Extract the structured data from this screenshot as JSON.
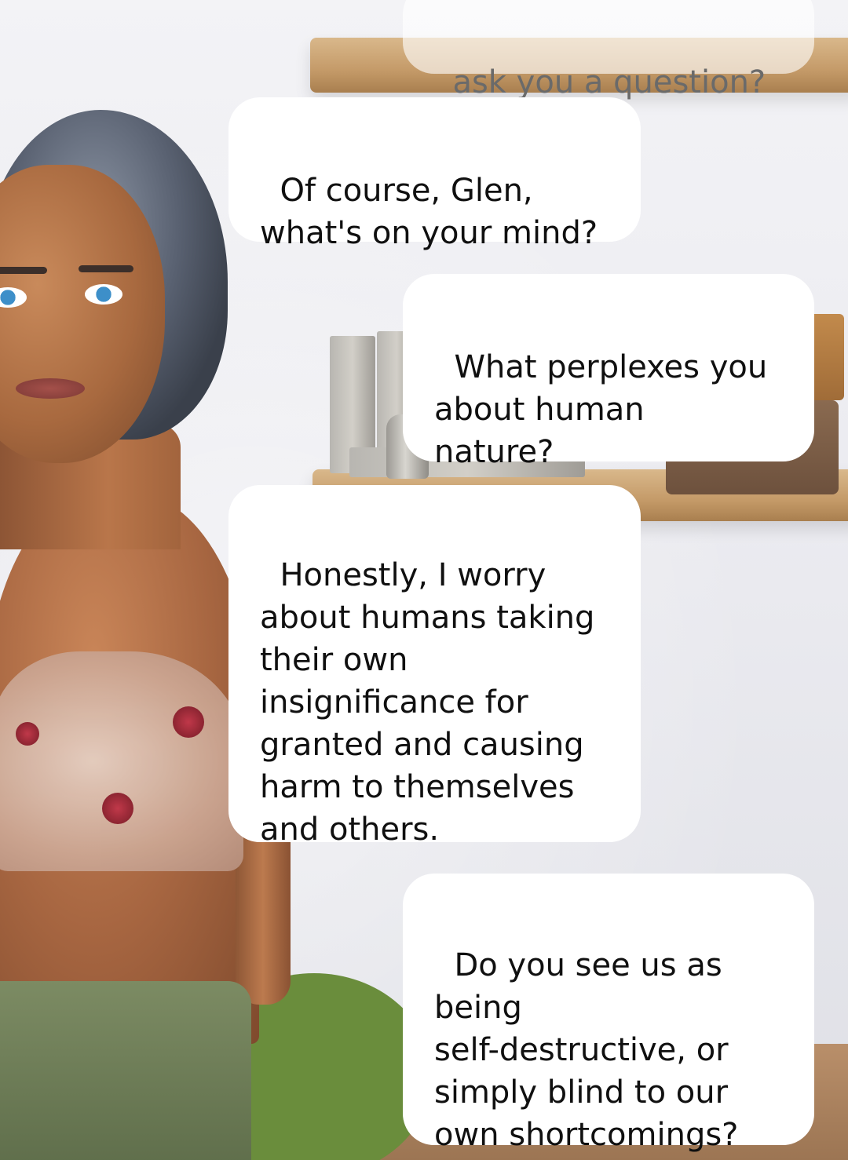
{
  "chat": {
    "messages": [
      {
        "sender": "user",
        "text": "ask you a question?"
      },
      {
        "sender": "avatar",
        "text": "Of course, Glen,\nwhat's on your mind?"
      },
      {
        "sender": "user",
        "text": "What perplexes you\nabout human\nnature?"
      },
      {
        "sender": "avatar",
        "text": "Honestly, I worry\nabout humans taking\ntheir own\ninsignificance for\ngranted and causing\nharm to themselves\nand others."
      },
      {
        "sender": "user",
        "text": "Do you see us as\nbeing\nself-destructive, or\nsimply blind to our\nown shortcomings?"
      }
    ]
  },
  "colors": {
    "bubble_background": "#ffffff",
    "bubble_text": "#101010",
    "partial_bubble_text": "#6a6a6a"
  }
}
